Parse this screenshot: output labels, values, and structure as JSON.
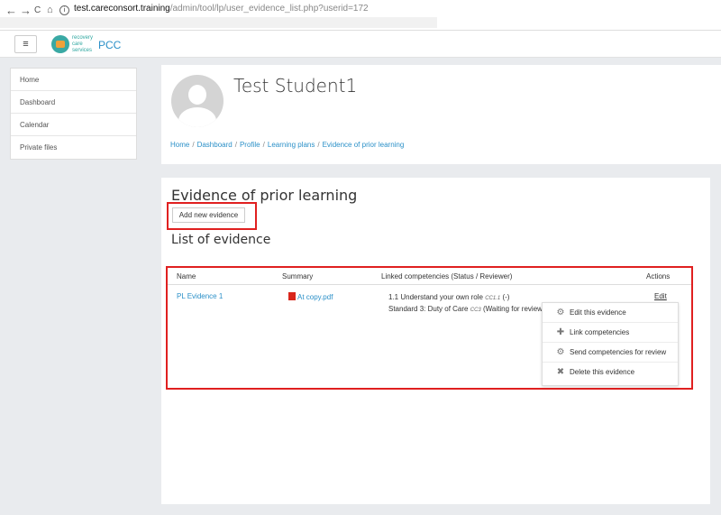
{
  "browser": {
    "back": "←",
    "forward": "→",
    "reload": "C",
    "home": "⌂",
    "info": "i",
    "url_host": "test.careconsort.training",
    "url_path": "/admin/tool/lp/user_evidence_list.php?userid=172"
  },
  "navbar": {
    "menu_glyph": "≡",
    "logo_line1": "recovery",
    "logo_line2": "care",
    "logo_line3": "services",
    "site_name": "PCC"
  },
  "sidebar": {
    "items": [
      {
        "label": "Home"
      },
      {
        "label": "Dashboard"
      },
      {
        "label": "Calendar"
      },
      {
        "label": "Private files"
      }
    ]
  },
  "header": {
    "user_name": "Test Student1",
    "breadcrumb": [
      "Home",
      "Dashboard",
      "Profile",
      "Learning plans",
      "Evidence of prior learning"
    ],
    "separator": "/"
  },
  "main": {
    "page_heading": "Evidence of prior learning",
    "add_button": "Add new evidence",
    "list_heading": "List of evidence",
    "columns": {
      "name": "Name",
      "summary": "Summary",
      "linked": "Linked competencies (Status / Reviewer)",
      "actions": "Actions"
    },
    "row": {
      "name": "PL Evidence 1",
      "file": "At copy.pdf",
      "comp1_text": "1.1 Understand your own role",
      "comp1_code": "CC1.1",
      "comp1_status": "(-)",
      "comp2_text": "Standard 3: Duty of Care",
      "comp2_code": "CC3",
      "comp2_status": "(Waiting for review)",
      "edit": "Edit"
    },
    "action_menu": [
      {
        "label": "Edit this evidence",
        "icon": "gear-icon",
        "glyph": "⚙"
      },
      {
        "label": "Link competencies",
        "icon": "plus-icon",
        "glyph": "✚"
      },
      {
        "label": "Send competencies for review",
        "icon": "gear-icon",
        "glyph": "⚙"
      },
      {
        "label": "Delete this evidence",
        "icon": "close-icon",
        "glyph": "✖"
      }
    ]
  },
  "colors": {
    "link": "#2b90c8",
    "highlight": "#e02020",
    "brand": "#2fa7a0"
  }
}
